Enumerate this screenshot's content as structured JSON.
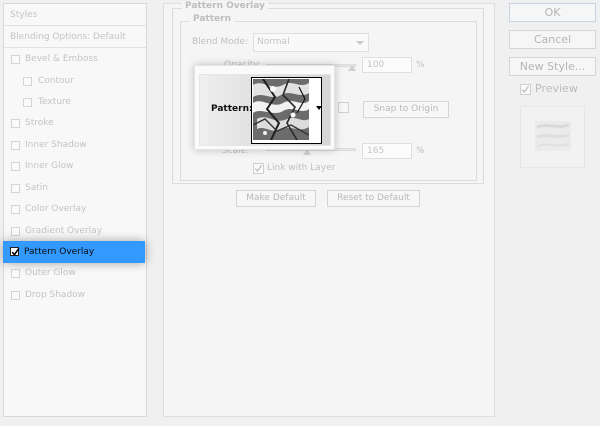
{
  "styles_panel": {
    "title": "Styles",
    "blending_options": "Blending Options: Default",
    "items": [
      {
        "label": "Bevel & Emboss",
        "checked": false
      },
      {
        "label": "Contour",
        "checked": false
      },
      {
        "label": "Texture",
        "checked": false
      },
      {
        "label": "Stroke",
        "checked": false
      },
      {
        "label": "Inner Shadow",
        "checked": false
      },
      {
        "label": "Inner Glow",
        "checked": false
      },
      {
        "label": "Satin",
        "checked": false
      },
      {
        "label": "Color Overlay",
        "checked": false
      },
      {
        "label": "Gradient Overlay",
        "checked": false
      },
      {
        "label": "Pattern Overlay",
        "checked": true,
        "selected": true
      },
      {
        "label": "Outer Glow",
        "checked": false
      },
      {
        "label": "Drop Shadow",
        "checked": false
      }
    ]
  },
  "pattern_overlay": {
    "section_title": "Pattern Overlay",
    "group_title": "Pattern",
    "blend_mode_label": "Blend Mode:",
    "blend_mode_value": "Normal",
    "opacity_label": "Opacity:",
    "opacity_value": "100",
    "opacity_unit": "%",
    "pattern_label": "Pattern:",
    "snap_button": "Snap to Origin",
    "scale_label": "Scale:",
    "scale_value": "165",
    "scale_unit": "%",
    "link_label": "Link with Layer",
    "link_checked": true,
    "make_default": "Make Default",
    "reset_default": "Reset to Default"
  },
  "buttons": {
    "ok": "OK",
    "cancel": "Cancel",
    "new_style": "New Style..."
  },
  "preview": {
    "label": "Preview",
    "checked": true
  },
  "colors": {
    "selection": "#3399ff",
    "background": "#f0f0f0"
  }
}
